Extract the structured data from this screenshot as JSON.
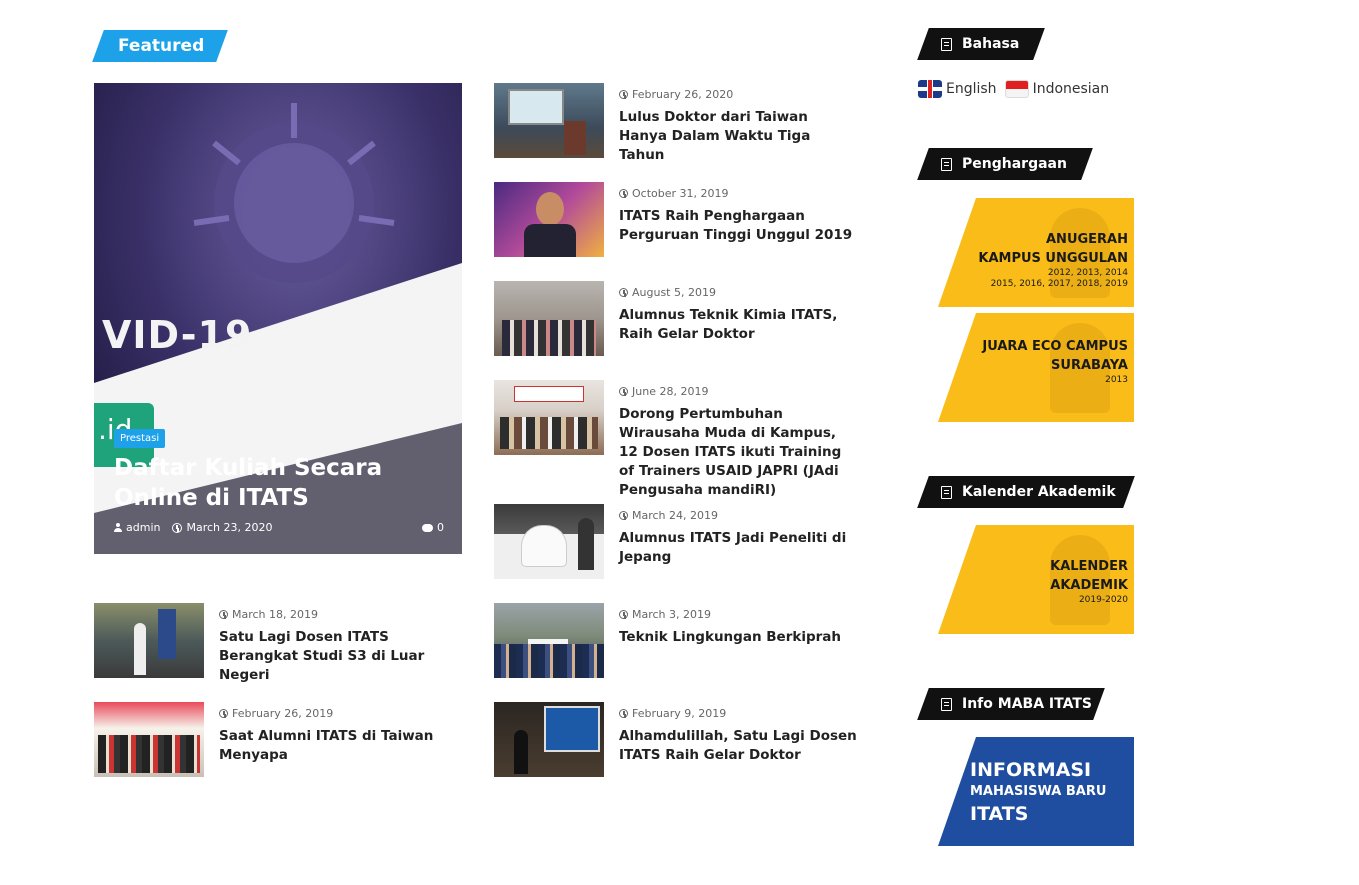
{
  "featured": {
    "label": "Featured",
    "hero": {
      "category": "Prestasi",
      "title": "Daftar Kuliah Secara Online di ITATS",
      "author": "admin",
      "date": "March 23, 2020",
      "comments": "0",
      "image_text": "VID-19",
      "image_badge": ".id"
    }
  },
  "posts": [
    {
      "date": "February 26, 2020",
      "title": "Lulus Doktor dari Taiwan Hanya Dalam Waktu Tiga Tahun"
    },
    {
      "date": "October 31, 2019",
      "title": "ITATS Raih Penghargaan Perguruan Tinggi Unggul 2019"
    },
    {
      "date": "August 5, 2019",
      "title": "Alumnus Teknik Kimia ITATS, Raih Gelar Doktor"
    },
    {
      "date": "June 28, 2019",
      "title": "Dorong Pertumbuhan Wirausaha Muda di Kampus, 12 Dosen ITATS ikuti Training of Trainers USAID JAPRI (JAdi Pengusaha mandiRI)"
    },
    {
      "date": "March 24, 2019",
      "title": "Alumnus ITATS Jadi Peneliti di Jepang"
    },
    {
      "date": "March 3, 2019",
      "title": "Teknik Lingkungan Berkiprah"
    },
    {
      "date": "February 9, 2019",
      "title": "Alhamdulillah, Satu Lagi Dosen ITATS Raih Gelar Doktor"
    },
    {
      "date": "March 18, 2019",
      "title": "Satu Lagi Dosen ITATS Berangkat Studi S3 di Luar Negeri"
    },
    {
      "date": "February 26, 2019",
      "title": "Saat Alumni ITATS di Taiwan Menyapa"
    }
  ],
  "sidebar": {
    "bahasa": {
      "title": "Bahasa",
      "languages": [
        {
          "label": "English",
          "flag": "en-flag"
        },
        {
          "label": "Indonesian",
          "flag": "id-flag"
        }
      ]
    },
    "penghargaan": {
      "title": "Penghargaan",
      "banners": [
        {
          "line1": "ANUGERAH",
          "line2": "KAMPUS UNGGULAN",
          "line3": "2012, 2013, 2014",
          "line4": "2015, 2016, 2017, 2018, 2019"
        },
        {
          "line1": "JUARA ECO CAMPUS",
          "line2": "SURABAYA",
          "line3": "2013"
        }
      ]
    },
    "kalender": {
      "title": "Kalender Akademik",
      "banner": {
        "line1": "KALENDER",
        "line2": "AKADEMIK",
        "line3": "2019-2020"
      }
    },
    "maba": {
      "title": "Info MABA ITATS",
      "banner": {
        "line1": "INFORMASI",
        "line2": "MAHASISWA BARU",
        "line3": "ITATS"
      }
    }
  },
  "colors": {
    "accent": "#1da1e9",
    "label_dark": "#111111",
    "banner_yellow": "#f9bc18",
    "banner_blue": "#1f4ea1"
  }
}
